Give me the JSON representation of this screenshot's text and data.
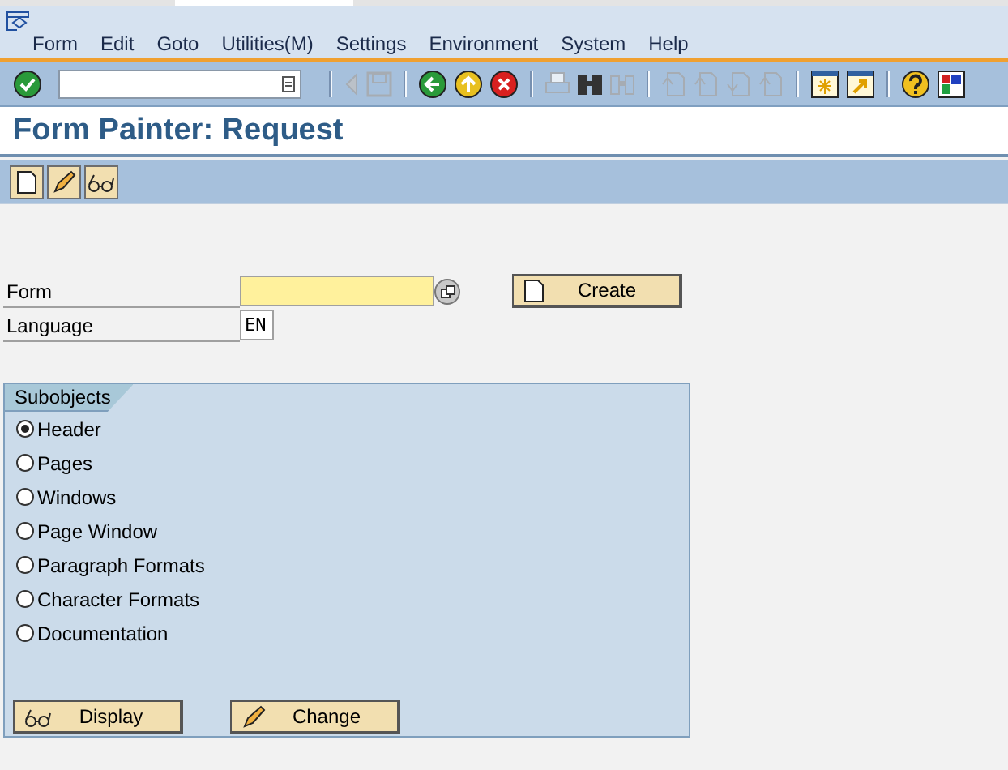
{
  "menu": [
    "Form",
    "Edit",
    "Goto",
    "Utilities(M)",
    "Settings",
    "Environment",
    "System",
    "Help"
  ],
  "toolbar": [
    {
      "kind": "enter",
      "disabled": false
    },
    {
      "kind": "command"
    },
    {
      "kind": "sep"
    },
    {
      "kind": "prev",
      "disabled": true
    },
    {
      "kind": "save",
      "disabled": true
    },
    {
      "kind": "sep"
    },
    {
      "kind": "back",
      "disabled": false
    },
    {
      "kind": "exit",
      "disabled": false
    },
    {
      "kind": "cancel",
      "disabled": false
    },
    {
      "kind": "sep"
    },
    {
      "kind": "print",
      "disabled": true
    },
    {
      "kind": "find",
      "disabled": false
    },
    {
      "kind": "findnext",
      "disabled": true
    },
    {
      "kind": "sep"
    },
    {
      "kind": "first",
      "disabled": true
    },
    {
      "kind": "up",
      "disabled": true
    },
    {
      "kind": "down",
      "disabled": true
    },
    {
      "kind": "last",
      "disabled": true
    },
    {
      "kind": "sep"
    },
    {
      "kind": "session",
      "disabled": false
    },
    {
      "kind": "shortcut",
      "disabled": false
    },
    {
      "kind": "sep"
    },
    {
      "kind": "help",
      "disabled": false
    },
    {
      "kind": "layout",
      "disabled": false
    }
  ],
  "title": "Form Painter: Request",
  "app_toolbar": [
    {
      "kind": "create"
    },
    {
      "kind": "change"
    },
    {
      "kind": "display"
    }
  ],
  "fields": [
    {
      "label": "Form",
      "kind": "form"
    },
    {
      "label": "Language",
      "value": "EN",
      "kind": "lang"
    }
  ],
  "create_button": {
    "label": "Create",
    "kind": "create"
  },
  "subobjects": {
    "title": "Subobjects",
    "options": [
      {
        "label": "Header",
        "selected": true
      },
      {
        "label": "Pages",
        "selected": false
      },
      {
        "label": "Windows",
        "selected": false
      },
      {
        "label": "Page Window",
        "selected": false
      },
      {
        "label": "Paragraph Formats",
        "selected": false
      },
      {
        "label": "Character Formats",
        "selected": false
      },
      {
        "label": "Documentation",
        "selected": false
      }
    ]
  },
  "buttons": [
    {
      "label": "Display",
      "kind": "display"
    },
    {
      "label": "Change",
      "kind": "change"
    }
  ]
}
